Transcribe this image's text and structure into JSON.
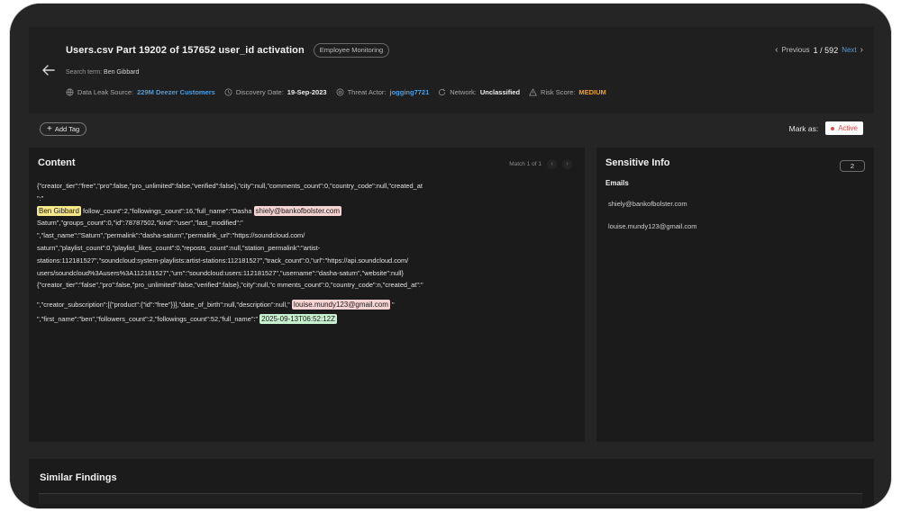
{
  "header": {
    "title": "Users.csv Part 19202 of 157652 user_id activation",
    "category_tag": "Employee Monitoring",
    "search_label": "Search term:",
    "search_value": "Ben Gibbard",
    "meta": {
      "leak_label": "Data Leak Source:",
      "leak_value": "229M Deezer Customers",
      "date_label": "Discovery Date:",
      "date_value": "19-Sep-2023",
      "actor_label": "Threat Actor:",
      "actor_value": "jogging7721",
      "network_label": "Network:",
      "network_value": "Unclassified",
      "risk_label": "Risk Score:",
      "risk_value": "MEDIUM"
    },
    "pager": {
      "previous": "Previous",
      "current": "1 / 592",
      "next": "Next"
    }
  },
  "toolbar": {
    "add_tag": "Add Tag",
    "mark_as": "Mark as:",
    "status": "Active"
  },
  "content": {
    "title": "Content",
    "match": "Match 1 of 1",
    "lines": {
      "l1": "{\"creator_tier\":\"free\",\"pro\":false,\"pro_unlimited\":false,\"verified\":false},\"city\":null,\"comments_count\":0,\"country_code\":null,\"created_at",
      "l2": "\":\"",
      "l3_hl": "Ben Gibbard",
      "l3_mid": " follow_count\":2,\"followings_count\":16,\"full_name\":\"Dasha ",
      "l3_email": "shiely@bankofbolster.com",
      "l4": "Saturn\",\"groups_count\":0,\"id\":78787502,\"kind\":\"user\",\"last_modified\":\"",
      "l5": "\",\"last_name\":\"Saturn\",\"permalink\":\"dasha-saturn\",\"permalink_url\":\"https://soundcloud.com/",
      "l6": "saturn\",\"playlist_count\":0,\"playlist_likes_count\":0,\"reposts_count\":null,\"station_permalink\":\"artist-",
      "l7": "stations:112181527\",\"soundcloud:system-playlists:artist-stations:112181527\",\"track_count\":0,\"url\":\"https://api.soundcloud.com/",
      "l8": "users/soundcloud%3Ausers%3A112181527\",\"urn\":\"soundcloud:users:112181527\",\"username\":\"dasha-saturn\",\"website\":null}",
      "l9": "{\"creator_tier\":\"false\",\"pro\":false,\"pro_unlimited\":false,\"verified\":false},\"city\":null,\"c   mments_count\":0,\"country_code\":n,\"created_at\":\"",
      "l10_pre": "\",\"creator_subscription\":[{\"product\":{\"id\":\"free\"}}],\"date_of_birth\":null,\"description\":null,\" ",
      "l10_email": "louise.mundy123@gmail.com",
      "l10_post": " \"",
      "l11_pre": " \",\"first_name\":\"ben\",\"followers_count\":2,\"followings_count\":52,\"full_name\":\" ",
      "l11_date": "2025-09-13T06:52:12Z"
    }
  },
  "sensitive": {
    "title": "Sensitive Info",
    "count": "2",
    "emails_label": "Emails",
    "emails": [
      "shiely@bankofbolster.com",
      "louise.mundy123@gmail.com"
    ]
  },
  "similar": {
    "title": "Similar Findings"
  },
  "colors": {
    "accent_blue": "#4a9fe3",
    "risk_orange": "#f0a028",
    "status_red": "#e24b4b"
  }
}
